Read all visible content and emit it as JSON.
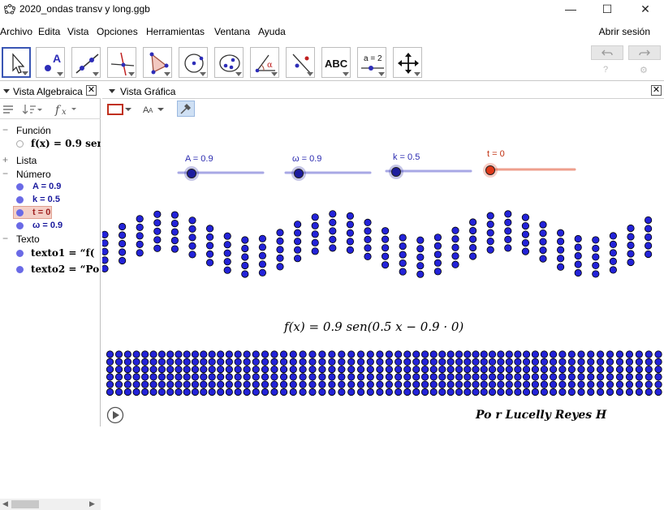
{
  "window": {
    "title": "2020_ondas transv y long.ggb",
    "controls": {
      "minimize": "—",
      "maximize": "☐",
      "close": "✕"
    }
  },
  "menu": {
    "items": [
      "Archivo",
      "Edita",
      "Vista",
      "Opciones",
      "Herramientas",
      "Ventana",
      "Ayuda"
    ],
    "signin": "Abrir sesión"
  },
  "toolbar": {
    "tools": [
      {
        "name": "move-tool-button",
        "icon": "arrow-cursor-icon",
        "active": true
      },
      {
        "name": "point-tool-button",
        "icon": "point-A-icon",
        "label": "A"
      },
      {
        "name": "line-tool-button",
        "icon": "line-icon"
      },
      {
        "name": "perpendicular-tool-button",
        "icon": "perpendicular-icon"
      },
      {
        "name": "polygon-tool-button",
        "icon": "polygon-icon"
      },
      {
        "name": "circle-tool-button",
        "icon": "circle-icon"
      },
      {
        "name": "ellipse-tool-button",
        "icon": "ellipse-icon"
      },
      {
        "name": "angle-tool-button",
        "icon": "angle-icon",
        "label": "α"
      },
      {
        "name": "reflect-tool-button",
        "icon": "reflect-icon"
      },
      {
        "name": "text-tool-button",
        "icon": "text-icon",
        "label": "ABC"
      },
      {
        "name": "slider-tool-button",
        "icon": "slider-icon",
        "label": "a = 2"
      },
      {
        "name": "move-view-tool-button",
        "icon": "move-view-icon"
      }
    ],
    "undo_icon": "undo-icon",
    "redo_icon": "redo-icon",
    "help_icon": "help-icon",
    "settings_icon": "gear-icon"
  },
  "algebra": {
    "title": "Vista Algebraica",
    "categories": {
      "funcion": "Función",
      "lista": "Lista",
      "numero": "Número",
      "texto": "Texto"
    },
    "function_entry": "f(x) = 0.9 sen",
    "numbers": [
      {
        "label": "A = 0.9"
      },
      {
        "label": "k = 0.5"
      },
      {
        "label": "t = 0",
        "selected": true
      },
      {
        "label": "ω = 0.9"
      }
    ],
    "texts": [
      {
        "label": "texto1 = “f("
      },
      {
        "label": "texto2 = “Po"
      }
    ]
  },
  "graphics": {
    "title": "Vista Gráfica",
    "sliders": [
      {
        "label": "A = 0.9",
        "value": 0.9,
        "min": 0,
        "max": 5,
        "color": "#6060d0"
      },
      {
        "label": "ω = 0.9",
        "value": 0.9,
        "min": 0,
        "max": 5,
        "color": "#6060d0"
      },
      {
        "label": "k = 0.5",
        "value": 0.5,
        "min": 0,
        "max": 5,
        "color": "#6060d0"
      },
      {
        "label": "t = 0",
        "value": 0,
        "min": 0,
        "max": 10,
        "color": "#e05030"
      }
    ],
    "formula": "f(x) = 0.9  sen(0.5 x − 0.9 · 0)",
    "credit": "Po r Lucelly Reyes H",
    "play_icon": "play-icon",
    "colors": {
      "accent": "#3a56b4",
      "point": "#2323d8",
      "t_slider": "#e05030"
    }
  }
}
